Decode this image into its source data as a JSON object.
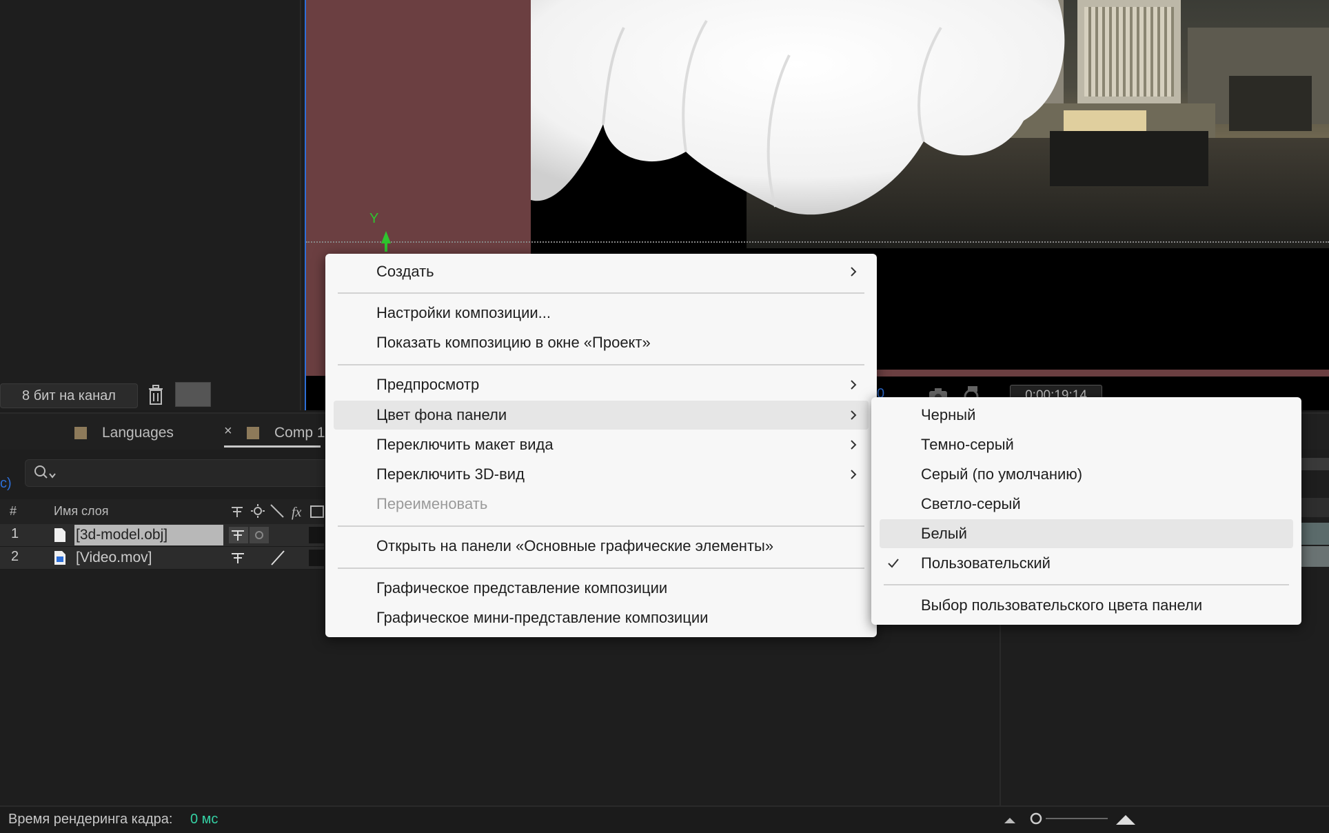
{
  "project_panel": {
    "bit_depth": "8 бит на канал"
  },
  "viewer": {
    "axis_label": "Y",
    "timecode": "0:00:19:14",
    "toolbar_fragment": "0"
  },
  "timeline": {
    "tabs": [
      {
        "label": "Languages"
      },
      {
        "label": "Comp 1"
      }
    ],
    "close_glyph": "×",
    "left_fragment": "c)",
    "columns": {
      "num": "#",
      "name": "Имя слоя"
    },
    "layers": [
      {
        "num": "1",
        "name": "[3d-model.obj]"
      },
      {
        "num": "2",
        "name": "[Video.mov]"
      }
    ]
  },
  "status": {
    "render_label": "Время рендеринга кадра:",
    "render_value": "0 мс"
  },
  "context_menu": {
    "items": [
      {
        "label": "Создать",
        "submenu": true
      },
      {
        "label": "Настройки композиции..."
      },
      {
        "label": "Показать композицию в окне «Проект»"
      },
      {
        "label": "Предпросмотр",
        "submenu": true
      },
      {
        "label": "Цвет фона панели",
        "submenu": true,
        "highlighted": true
      },
      {
        "label": "Переключить макет вида",
        "submenu": true
      },
      {
        "label": "Переключить 3D-вид",
        "submenu": true
      },
      {
        "label": "Переименовать",
        "disabled": true
      },
      {
        "label": "Открыть на панели «Основные графические элементы»"
      },
      {
        "label": "Графическое представление композиции"
      },
      {
        "label": "Графическое мини-представление композиции"
      }
    ]
  },
  "submenu": {
    "items": [
      {
        "label": "Черный"
      },
      {
        "label": "Темно-серый"
      },
      {
        "label": "Серый (по умолчанию)"
      },
      {
        "label": "Светло-серый"
      },
      {
        "label": "Белый",
        "highlighted": true
      },
      {
        "label": "Пользовательский",
        "checked": true
      },
      {
        "label": "Выбор пользовательского цвета панели"
      }
    ]
  },
  "colors": {
    "accent_blue": "#2d6fd8",
    "render_value": "#35d2a5",
    "viewer_background": "#6b3f41",
    "axis_green": "#2ec52e",
    "menu_background": "#f7f7f7"
  }
}
